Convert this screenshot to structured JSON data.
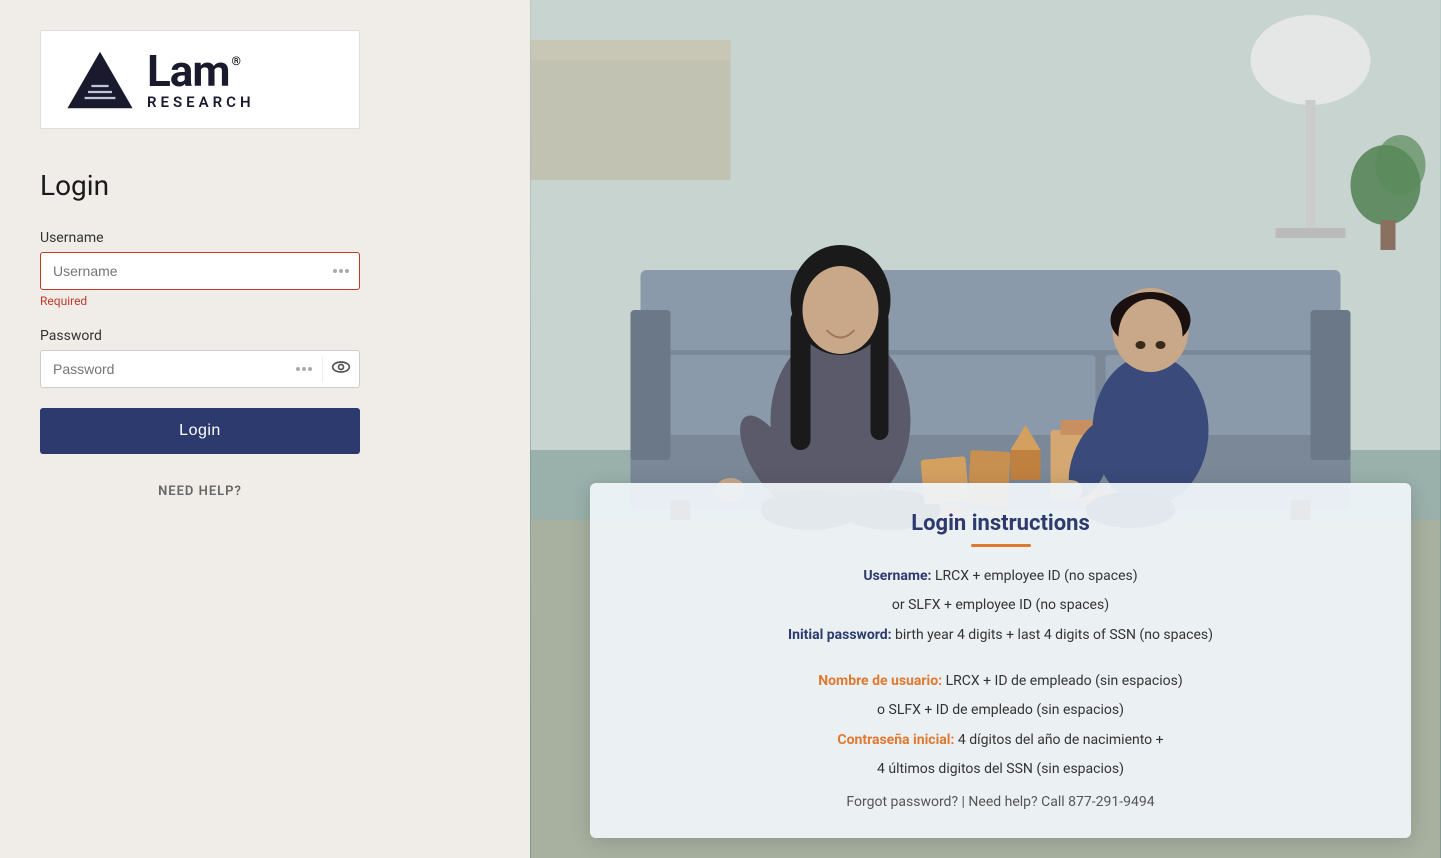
{
  "left": {
    "logo": {
      "lam_text": "Lam",
      "research_text": "RESEARCH",
      "registered_symbol": "®"
    },
    "login_title": "Login",
    "username_label": "Username",
    "username_placeholder": "Username",
    "username_required": "Required",
    "password_label": "Password",
    "password_placeholder": "Password",
    "login_button_label": "Login",
    "need_help_label": "NEED HELP?"
  },
  "right": {
    "card": {
      "title": "Login instructions",
      "line1_label": "Username:",
      "line1_text": "LRCX + employee ID (no spaces)",
      "line1b_text": "or SLFX + employee ID (no spaces)",
      "line2_label": "Initial password:",
      "line2_text": "birth year 4 digits + last 4 digits of SSN (no spaces)",
      "line3_label": "Nombre de usuario:",
      "line3_text": "LRCX + ID de empleado (sin espacios)",
      "line3b_text": "o SLFX + ID de empleado (sin espacios)",
      "line4_label": "Contraseña inicial:",
      "line4_text": "4 dígitos del año de nacimiento +",
      "line4b_text": "4 últimos digitos del SSN (sin espacios)",
      "footer": "Forgot password? | Need help? Call 877-291-9494"
    }
  }
}
